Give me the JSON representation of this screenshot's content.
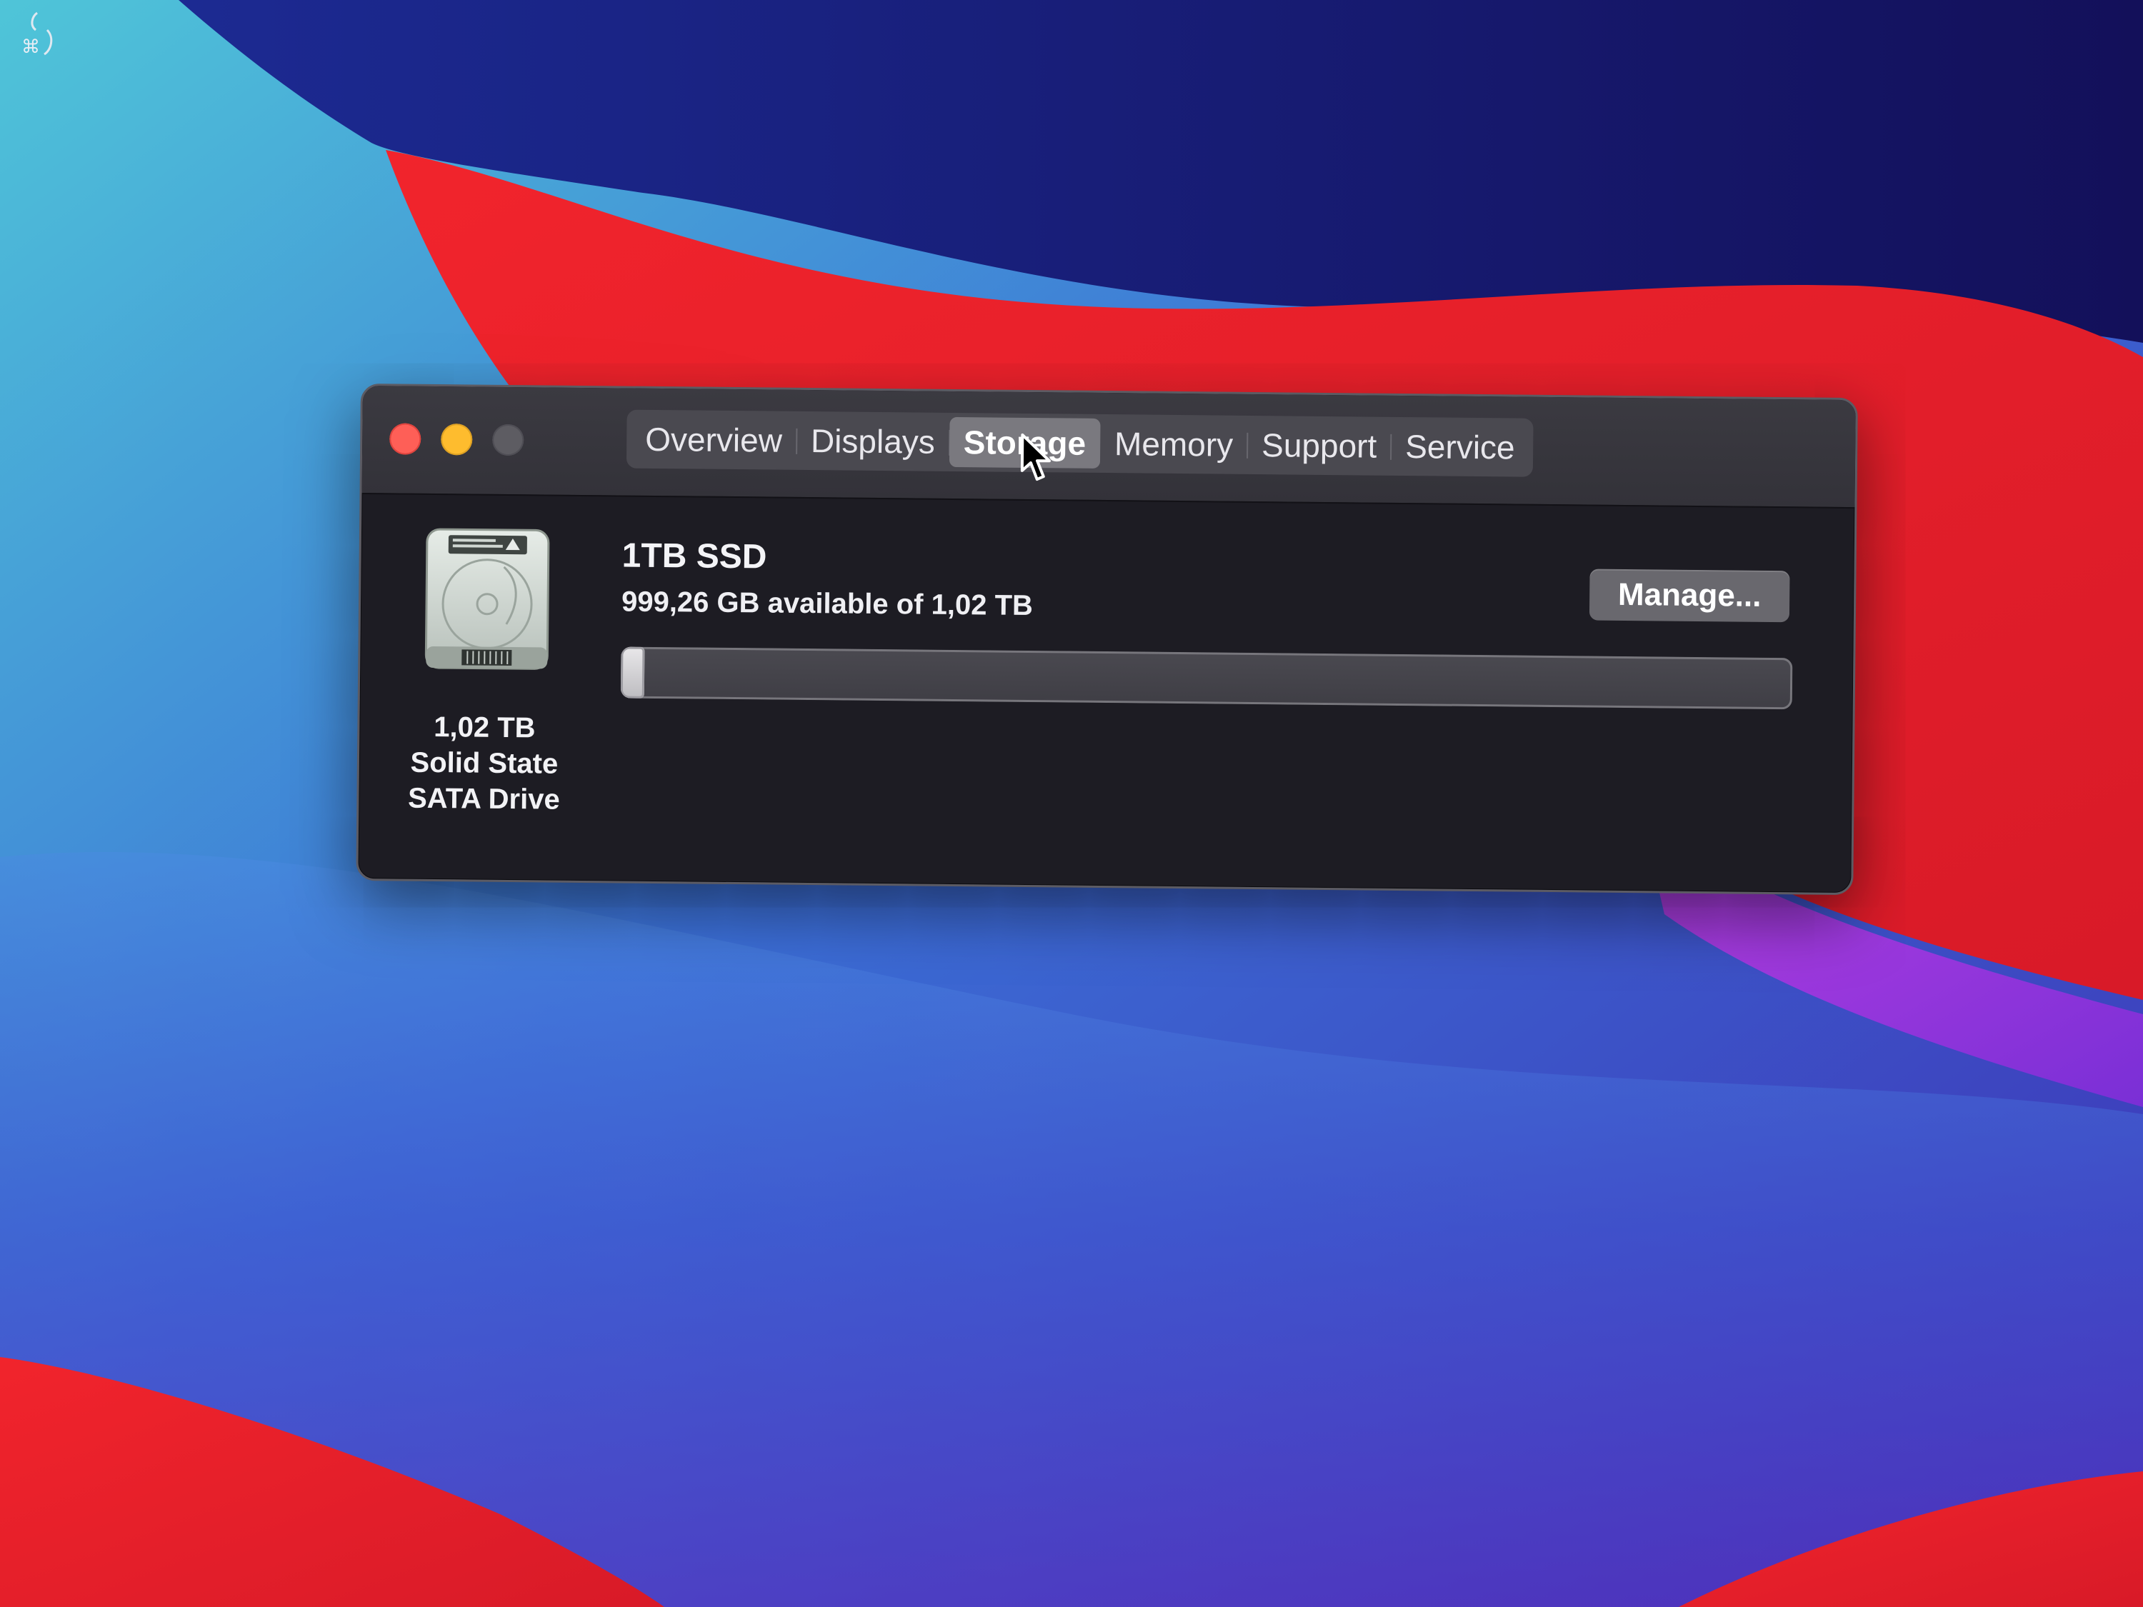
{
  "window": {
    "tabs": [
      {
        "label": "Overview",
        "active": false
      },
      {
        "label": "Displays",
        "active": false
      },
      {
        "label": "Storage",
        "active": true
      },
      {
        "label": "Memory",
        "active": false
      },
      {
        "label": "Support",
        "active": false
      },
      {
        "label": "Service",
        "active": false
      }
    ],
    "traffic_lights": {
      "close_color": "#fe5f57",
      "minimize_color": "#febc2e",
      "zoom_color": "#5d5c62"
    }
  },
  "storage": {
    "disk_icon": "hard-drive-icon",
    "capacity": "1,02 TB",
    "type_line1": "Solid State",
    "type_line2": "SATA Drive",
    "name": "1TB SSD",
    "available_text": "999,26 GB available of 1,02 TB",
    "used_fraction": 0.02,
    "manage_label": "Manage..."
  },
  "colors": {
    "window_background": "#1d1c23",
    "titlebar": "#38373e",
    "selected_tab": "#7a797f"
  }
}
